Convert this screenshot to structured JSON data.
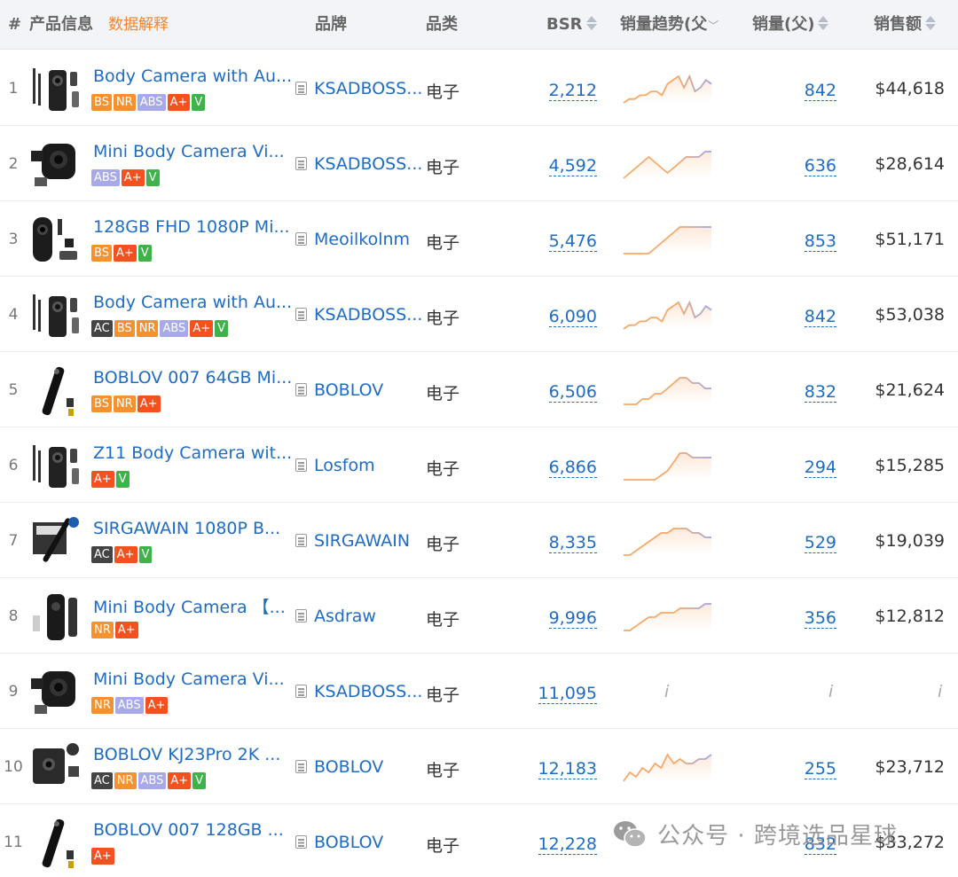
{
  "header": {
    "num": "#",
    "info": "产品信息",
    "explain": "数据解释",
    "brand": "品牌",
    "category": "品类",
    "bsr": "BSR",
    "trend": "销量趋势(父",
    "qty": "销量(父)",
    "revenue": "销售额"
  },
  "colors": {
    "link": "#1e6cc6",
    "accent_orange": "#f5842a",
    "trend_line": "#f8a867",
    "trend_line_end": "#9ba6ee"
  },
  "rows": [
    {
      "num": "1",
      "title": "Body Camera with Au...",
      "badges": [
        "BS",
        "NR",
        "ABS",
        "A+",
        "V"
      ],
      "brand": "KSADBOSS...",
      "category": "电子",
      "bsr": "2,212",
      "qty": "842",
      "revenue": "$44,618",
      "trend": [
        2,
        3,
        3,
        4,
        4,
        5,
        5,
        4,
        7,
        8,
        9,
        6,
        9,
        5,
        6,
        8,
        7
      ],
      "has_trend": true,
      "image": "camera-kit"
    },
    {
      "num": "2",
      "title": "Mini Body Camera Vi...",
      "badges": [
        "ABS",
        "A+",
        "V"
      ],
      "brand": "KSADBOSS...",
      "category": "电子",
      "bsr": "4,592",
      "qty": "636",
      "revenue": "$28,614",
      "trend": [
        3,
        4,
        5,
        6,
        7,
        6,
        5,
        4,
        5,
        6,
        7,
        7,
        7,
        8,
        8
      ],
      "has_trend": true,
      "image": "mini-cam"
    },
    {
      "num": "3",
      "title": "128GB FHD 1080P Mi...",
      "badges": [
        "BS",
        "A+",
        "V"
      ],
      "brand": "Meoilkolnm",
      "category": "电子",
      "bsr": "5,476",
      "qty": "853",
      "revenue": "$51,171",
      "trend": [
        2,
        2,
        2,
        2,
        2,
        3,
        4,
        5,
        6,
        7,
        7,
        7,
        7,
        7,
        7
      ],
      "has_trend": true,
      "image": "cylinder-cam"
    },
    {
      "num": "4",
      "title": "Body Camera with Au...",
      "badges": [
        "AC",
        "BS",
        "NR",
        "ABS",
        "A+",
        "V"
      ],
      "brand": "KSADBOSS...",
      "category": "电子",
      "bsr": "6,090",
      "qty": "842",
      "revenue": "$53,038",
      "trend": [
        2,
        3,
        3,
        4,
        4,
        5,
        5,
        4,
        7,
        8,
        9,
        6,
        9,
        5,
        6,
        8,
        7
      ],
      "has_trend": true,
      "image": "camera-kit"
    },
    {
      "num": "5",
      "title": "BOBLOV 007 64GB Mi...",
      "badges": [
        "BS",
        "NR",
        "A+"
      ],
      "brand": "BOBLOV",
      "category": "电子",
      "bsr": "6,506",
      "qty": "832",
      "revenue": "$21,624",
      "trend": [
        2,
        2,
        2,
        3,
        3,
        4,
        4,
        5,
        6,
        7,
        7,
        6,
        6,
        5,
        5
      ],
      "has_trend": true,
      "image": "pen-cam"
    },
    {
      "num": "6",
      "title": "Z11 Body Camera wit...",
      "badges": [
        "A+",
        "V"
      ],
      "brand": "Losfom",
      "category": "电子",
      "bsr": "6,866",
      "qty": "294",
      "revenue": "$15,285",
      "trend": [
        2,
        2,
        2,
        2,
        2,
        2,
        3,
        4,
        6,
        8,
        8,
        7,
        7,
        7,
        7
      ],
      "has_trend": true,
      "image": "camera-kit"
    },
    {
      "num": "7",
      "title": "SIRGAWAIN 1080P B...",
      "badges": [
        "AC",
        "A+",
        "V"
      ],
      "brand": "SIRGAWAIN",
      "category": "电子",
      "bsr": "8,335",
      "qty": "529",
      "revenue": "$19,039",
      "trend": [
        2,
        2,
        3,
        4,
        5,
        6,
        7,
        7,
        8,
        8,
        8,
        7,
        7,
        6,
        6
      ],
      "has_trend": true,
      "image": "pen-box"
    },
    {
      "num": "8",
      "title": "Mini Body Camera 【...",
      "badges": [
        "NR",
        "A+"
      ],
      "brand": "Asdraw",
      "category": "电子",
      "bsr": "9,996",
      "qty": "356",
      "revenue": "$12,812",
      "trend": [
        2,
        2,
        3,
        4,
        5,
        5,
        6,
        6,
        6,
        7,
        7,
        7,
        7,
        8,
        8
      ],
      "has_trend": true,
      "image": "slim-cam"
    },
    {
      "num": "9",
      "title": "Mini Body Camera Vi...",
      "badges": [
        "NR",
        "ABS",
        "A+"
      ],
      "brand": "KSADBOSS...",
      "category": "电子",
      "bsr": "11,095",
      "qty": "i",
      "revenue": "i",
      "trend": [],
      "has_trend": false,
      "trend_placeholder": "i",
      "image": "mini-cam"
    },
    {
      "num": "10",
      "title": "BOBLOV KJ23Pro 2K ...",
      "badges": [
        "AC",
        "NR",
        "ABS",
        "A+",
        "V"
      ],
      "brand": "BOBLOV",
      "category": "电子",
      "bsr": "12,183",
      "qty": "255",
      "revenue": "$23,712",
      "trend": [
        2,
        4,
        3,
        5,
        4,
        6,
        5,
        8,
        6,
        7,
        6,
        6,
        7,
        7,
        8
      ],
      "has_trend": true,
      "image": "box-cam"
    },
    {
      "num": "11",
      "title": "BOBLOV 007 128GB ...",
      "badges": [
        "A+"
      ],
      "brand": "BOBLOV",
      "category": "电子",
      "bsr": "12,228",
      "qty": "832",
      "revenue": "$33,272",
      "trend": [],
      "has_trend": false,
      "trend_placeholder": "",
      "image": "pen-cam"
    }
  ],
  "watermark": {
    "icon": "wechat-icon",
    "text": "公众号 · 跨境选品星球"
  }
}
